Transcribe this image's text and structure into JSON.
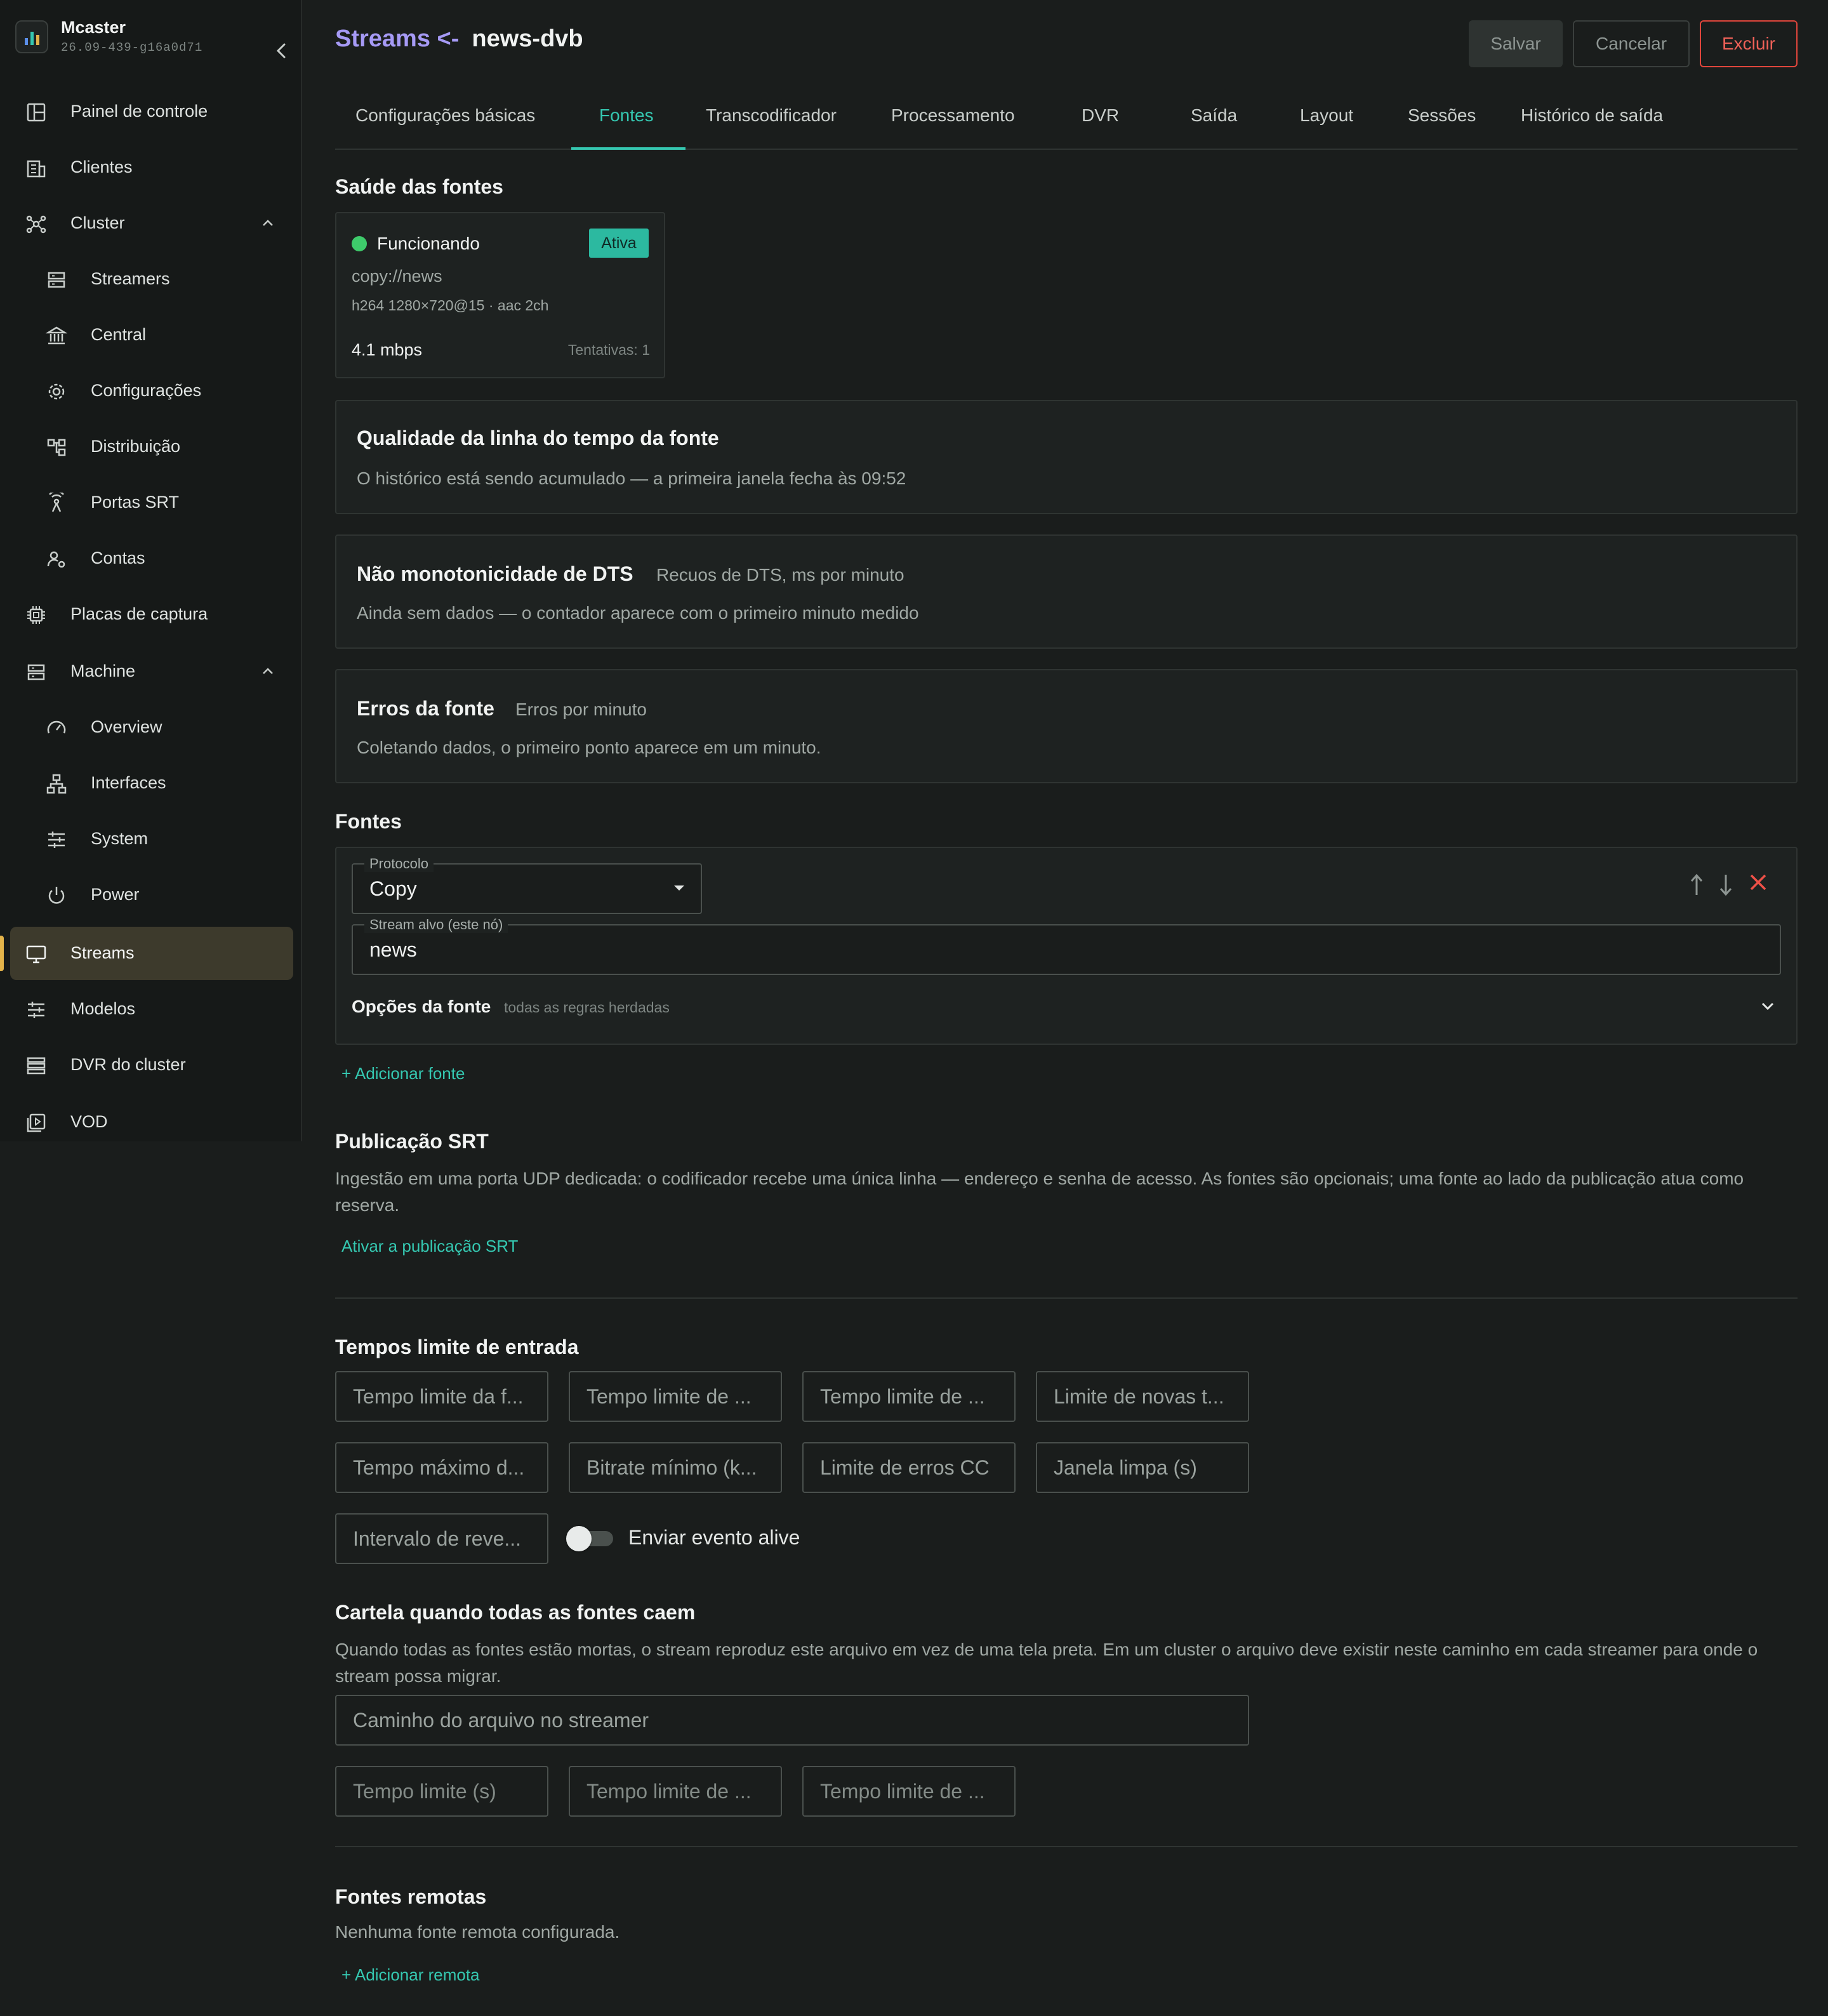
{
  "app": {
    "name": "Mcaster",
    "version": "26.09-439-g16a0d71"
  },
  "sidebar": {
    "items": [
      {
        "label": "Painel de controle",
        "icon": "dashboard-icon"
      },
      {
        "label": "Clientes",
        "icon": "building-icon"
      },
      {
        "label": "Cluster",
        "icon": "cluster-icon",
        "expanded": true
      },
      {
        "label": "Streamers",
        "icon": "server-icon"
      },
      {
        "label": "Central",
        "icon": "bank-icon"
      },
      {
        "label": "Configurações",
        "icon": "gear-icon"
      },
      {
        "label": "Distribuição",
        "icon": "hierarchy-icon"
      },
      {
        "label": "Portas SRT",
        "icon": "antenna-icon"
      },
      {
        "label": "Contas",
        "icon": "user-gear-icon"
      },
      {
        "label": "Placas de captura",
        "icon": "chip-icon"
      },
      {
        "label": "Machine",
        "icon": "server-icon",
        "expanded": true
      },
      {
        "label": "Overview",
        "icon": "gauge-icon"
      },
      {
        "label": "Interfaces",
        "icon": "network-icon"
      },
      {
        "label": "System",
        "icon": "sliders-icon"
      },
      {
        "label": "Power",
        "icon": "power-icon"
      },
      {
        "label": "Streams",
        "icon": "monitor-icon",
        "active": true
      },
      {
        "label": "Modelos",
        "icon": "sliders-icon"
      },
      {
        "label": "DVR do cluster",
        "icon": "storage-icon"
      },
      {
        "label": "VOD",
        "icon": "play-icon"
      }
    ]
  },
  "header": {
    "back_link": "Streams <-",
    "stream_name": "news-dvb",
    "save_label": "Salvar",
    "cancel_label": "Cancelar",
    "delete_label": "Excluir"
  },
  "tabs": [
    {
      "label": "Configurações básicas"
    },
    {
      "label": "Fontes",
      "active": true
    },
    {
      "label": "Transcodificador"
    },
    {
      "label": "Processamento"
    },
    {
      "label": "DVR"
    },
    {
      "label": "Saída"
    },
    {
      "label": "Layout"
    },
    {
      "label": "Sessões"
    },
    {
      "label": "Histórico de saída"
    }
  ],
  "health": {
    "title": "Saúde das fontes",
    "card": {
      "status": "Funcionando",
      "badge": "Ativa",
      "url": "copy://news",
      "codec": "h264 1280×720@15 · aac 2ch",
      "bitrate": "4.1 mbps",
      "attempts": "Tentativas: 1",
      "status_color": "#3ecb6b"
    }
  },
  "panels": {
    "timeline": {
      "title": "Qualidade da linha do tempo da fonte",
      "text": "O histórico está sendo acumulado — a primeira janela fecha às 09:52"
    },
    "dts": {
      "title": "Não monotonicidade de DTS",
      "subtitle": "Recuos de DTS, ms por minuto",
      "text": "Ainda sem dados — o contador aparece com o primeiro minuto medido"
    },
    "errors": {
      "title": "Erros da fonte",
      "subtitle": "Erros por minuto",
      "text": "Coletando dados, o primeiro ponto aparece em um minuto."
    }
  },
  "sources": {
    "title": "Fontes",
    "protocol_label": "Protocolo",
    "protocol_value": "Copy",
    "target_label": "Stream alvo (este nó)",
    "target_value": "news",
    "options_label": "Opções da fonte",
    "options_hint": "todas as regras herdadas",
    "add_label": "+ Adicionar fonte"
  },
  "srt": {
    "title": "Publicação SRT",
    "text": "Ingestão em uma porta UDP dedicada: o codificador recebe uma única linha — endereço e senha de acesso. As fontes são opcionais; uma fonte ao lado da publicação atua como reserva.",
    "link": "Ativar a publicação SRT"
  },
  "timeouts": {
    "title": "Tempos limite de entrada",
    "fields": [
      "Tempo limite da f...",
      "Tempo limite de ...",
      "Tempo limite de ...",
      "Limite de novas t...",
      "Tempo máximo d...",
      "Bitrate mínimo (k...",
      "Limite de erros CC",
      "Janela limpa (s)",
      "Intervalo de reve..."
    ],
    "alive_label": "Enviar evento alive",
    "alive_on": false
  },
  "slate": {
    "title": "Cartela quando todas as fontes caem",
    "text": "Quando todas as fontes estão mortas, o stream reproduz este arquivo em vez de uma tela preta. Em um cluster o arquivo deve existir neste caminho em cada streamer para onde o stream possa migrar.",
    "path_placeholder": "Caminho do arquivo no streamer",
    "fields": [
      "Tempo limite (s)",
      "Tempo limite de ...",
      "Tempo limite de ..."
    ]
  },
  "remote": {
    "title": "Fontes remotas",
    "text": "Nenhuma fonte remota configurada.",
    "add_label": "+ Adicionar remota"
  }
}
